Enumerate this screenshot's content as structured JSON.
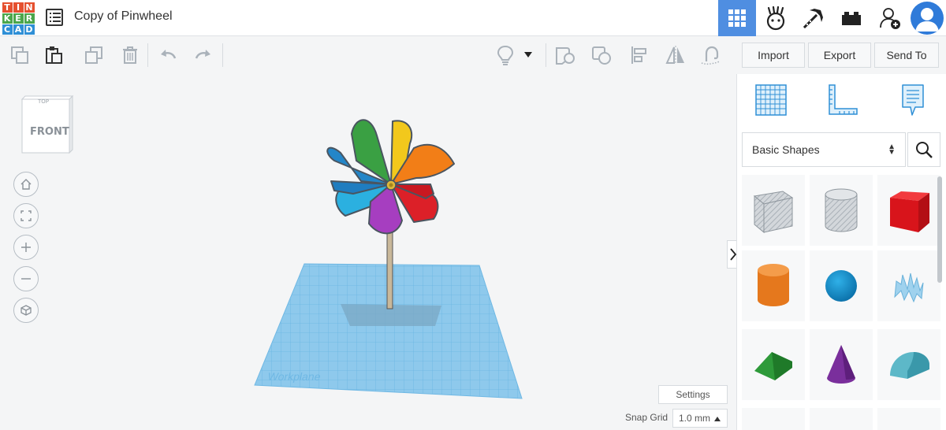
{
  "app": {
    "logo_letters": [
      "T",
      "I",
      "N",
      "K",
      "E",
      "R",
      "C",
      "A",
      "D"
    ],
    "title": "Copy of Pinwheel"
  },
  "header": {
    "icons": [
      "3d-design-grid-icon",
      "circuits-icon",
      "minecraft-pickaxe-icon",
      "brick-icon",
      "add-user-icon",
      "user-avatar-icon"
    ]
  },
  "toolbar": {
    "import_label": "Import",
    "export_label": "Export",
    "send_to_label": "Send To"
  },
  "viewcube": {
    "top_label": "TOP",
    "front_label": "FRONT"
  },
  "workplane": {
    "label": "Workplane"
  },
  "canvas": {
    "settings_label": "Settings",
    "snap_grid_label": "Snap Grid",
    "snap_grid_value": "1.0 mm"
  },
  "panel": {
    "shape_category": "Basic Shapes"
  },
  "colors": {
    "accent": "#4f8ee1",
    "workplane": "#8ec9ec"
  }
}
